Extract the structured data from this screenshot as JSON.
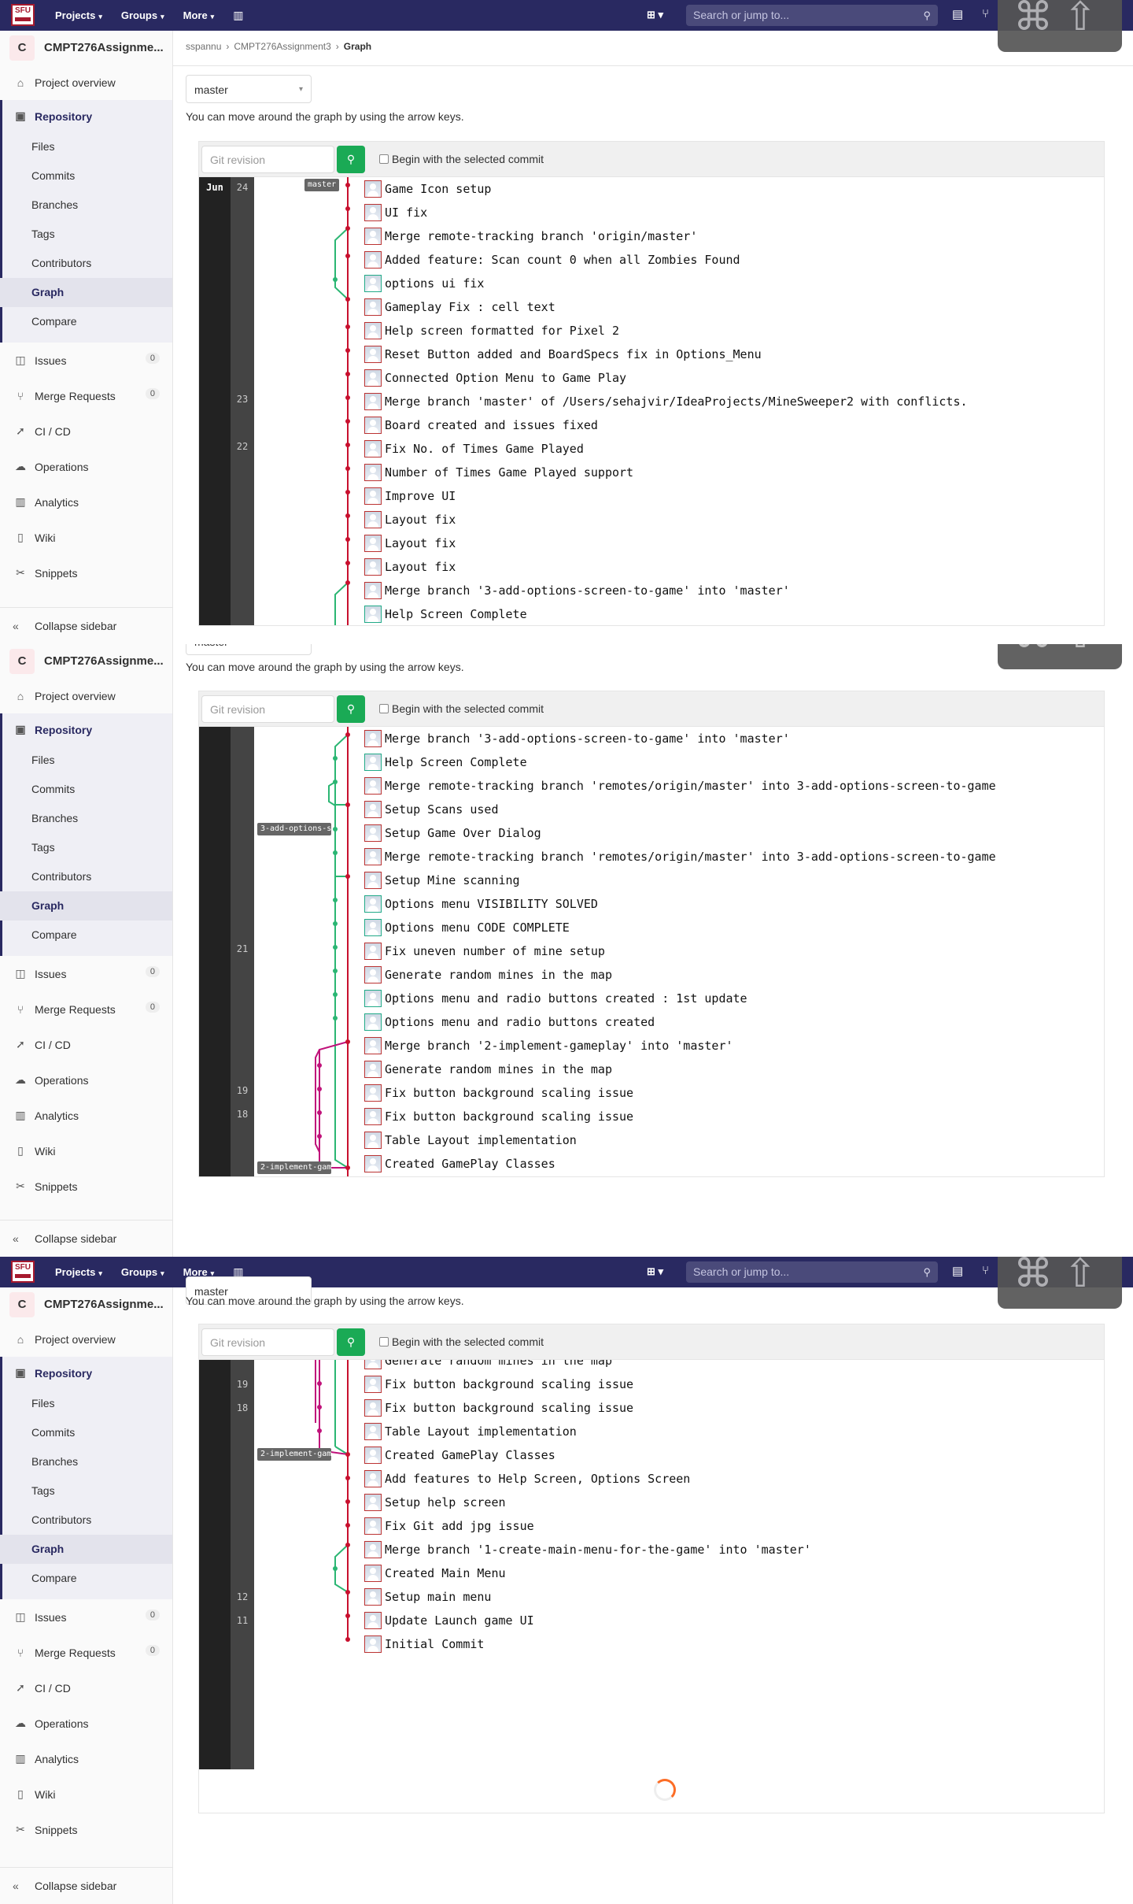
{
  "nav": {
    "logo_text": "SFU",
    "links": [
      "Projects",
      "Groups",
      "More"
    ],
    "search_placeholder": "Search or jump to...",
    "overlay_glyphs": "⌘⇧"
  },
  "sidebar": {
    "project_initial": "C",
    "project_name": "CMPT276Assignme...",
    "overview": "Project overview",
    "repository": "Repository",
    "repo_items": [
      "Files",
      "Commits",
      "Branches",
      "Tags",
      "Contributors",
      "Graph",
      "Compare"
    ],
    "issues": "Issues",
    "issues_count": "0",
    "merge_requests": "Merge Requests",
    "mr_count": "0",
    "cicd": "CI / CD",
    "operations": "Operations",
    "analytics": "Analytics",
    "wiki": "Wiki",
    "snippets": "Snippets",
    "collapse": "Collapse sidebar"
  },
  "breadcrumb": {
    "user": "sspannu",
    "project": "CMPT276Assignment3",
    "page": "Graph"
  },
  "branch_selected": "master",
  "hint": "You can move around the graph by using the arrow keys.",
  "controls": {
    "revision_placeholder": "Git revision",
    "begin_label": "Begin with the selected commit"
  },
  "graph1": {
    "month": "Jun",
    "days": [
      "24",
      "23",
      "22"
    ],
    "refs": [
      "master"
    ],
    "commits": [
      "Game Icon setup",
      "UI fix",
      "Merge remote-tracking branch 'origin/master'",
      "Added feature: Scan count 0 when all Zombies Found",
      "options ui fix",
      "Gameplay Fix : cell text",
      "Help screen formatted for Pixel 2",
      "Reset Button added and BoardSpecs fix in Options_Menu",
      "Connected Option Menu to Game Play",
      "Merge branch 'master' of /Users/sehajvir/IdeaProjects/MineSweeper2 with conflicts.",
      "Board created and issues fixed",
      "Fix No. of Times Game Played",
      "Number of Times Game Played support",
      "Improve UI",
      "Layout fix",
      "Layout fix",
      "Layout fix",
      "Merge branch '3-add-options-screen-to-game' into 'master'",
      "Help Screen Complete"
    ]
  },
  "graph2": {
    "days": [
      "21",
      "19",
      "18"
    ],
    "refs": [
      "3-add-options-s…",
      "2-implement-gam…"
    ],
    "commits": [
      "Merge branch '3-add-options-screen-to-game' into 'master'",
      "Help Screen Complete",
      "Merge remote-tracking branch 'remotes/origin/master' into 3-add-options-screen-to-game",
      "Setup Scans used",
      "Setup Game Over Dialog",
      "Merge remote-tracking branch 'remotes/origin/master' into 3-add-options-screen-to-game",
      "Setup Mine scanning",
      "Options menu VISIBILITY SOLVED",
      "Options menu CODE COMPLETE",
      "Fix uneven number of mine setup",
      "Generate random mines in the map",
      "Options menu and radio buttons created : 1st update",
      "Options menu and radio buttons created",
      "Merge branch '2-implement-gameplay' into 'master'",
      "Generate random mines in the map",
      "Fix button background scaling issue",
      "Fix button background scaling issue",
      "Table Layout implementation",
      "Created GamePlay Classes"
    ]
  },
  "graph3": {
    "days": [
      "19",
      "18",
      "12",
      "11"
    ],
    "refs": [
      "2-implement-gam…"
    ],
    "commits": [
      "Generate random mines in the map",
      "Fix button background scaling issue",
      "Fix button background scaling issue",
      "Table Layout implementation",
      "Created GamePlay Classes",
      "Add features to Help Screen, Options Screen",
      "Setup help screen",
      "Fix Git add jpg issue",
      "Merge branch '1-create-main-menu-for-the-game' into 'master'",
      "Created Main Menu",
      "Setup main menu",
      "Update Launch game UI",
      "Initial Commit"
    ]
  }
}
